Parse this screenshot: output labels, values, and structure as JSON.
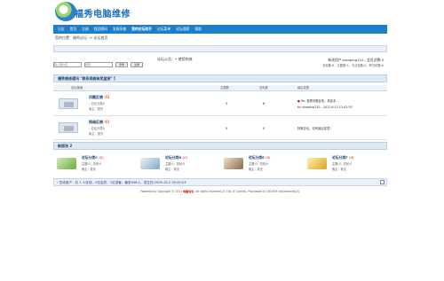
{
  "logo": {
    "name": "福秀电脑维修"
  },
  "nav": {
    "items": [
      "日志",
      "首页",
      "注册",
      "找回密码",
      "发表风格",
      "我的论坛助手",
      "论坛菜单",
      "论坛搜索",
      "帮助"
    ],
    "active_index": 5
  },
  "breadcrumb": "您的位置：福秀论坛 -> 论坛首页",
  "info": {
    "announce": "论坛公告：• 使用的体",
    "newest_member": "新进用户:xiaoping110，会员总数:3",
    "stats": "总帖数:8，主题数:5，今日帖数:0，昨日帖数:0"
  },
  "login": {
    "user_placeholder": "输入用户名",
    "pass_placeholder": "密码",
    "login_btn": "登录",
    "register_btn": "注册"
  },
  "section1": {
    "title": "福秀维修通讯 \"联系网络有奖鉴赏\" 】",
    "col_forum": "论坛版面",
    "col_topics": "主题数",
    "col_posts": "总帖数",
    "col_last": "最后发表"
  },
  "forums": [
    {
      "name": "问题反馈",
      "count": "(0)",
      "sub": "› 论坛分类A",
      "moderator": "版主：暂无",
      "topics": "5",
      "posts": "8",
      "last1": "Re: 宽屏问题反馈，求高手...",
      "last2": "by  xiaoping110 - 2012-6-12 11:03:55"
    },
    {
      "name": "网络反馈",
      "count": "(0)",
      "sub": "› 论坛分类B",
      "moderator": "版主：暂无",
      "topics": "0",
      "posts": "0",
      "last1": "",
      "last2": "特殊论坛，没有最后发表！"
    }
  ],
  "section2": {
    "title": "新版块 2"
  },
  "categories": [
    {
      "name": "论坛分类C",
      "count": "(0)",
      "line1": "主题:0，总帖:0",
      "line2": "版主：暂无"
    },
    {
      "name": "论坛分类D",
      "count": "(0)",
      "line1": "主题:0，总帖:0",
      "line2": "版主：暂无"
    },
    {
      "name": "论坛分类E",
      "count": "(0)",
      "line1": "主题:0，总帖:0",
      "line2": "版主：暂无"
    },
    {
      "name": "论坛分类F",
      "count": "(0)",
      "line1": "主题:0，总帖:0",
      "line2": "版主：暂无"
    }
  ],
  "status": "› 在线用户 - 共 1 人在线，0位会员，1位游客，最多506人，发生在:2009-10-2 20:05:23",
  "footer": {
    "prefix": "Powered by Copyright © 2011 ",
    "brand": "电脑论坛",
    "suffix": ". All rights reserved.21 Call, 8 Queries, Processed in 140.629 milliseconds(2)."
  },
  "colors": {
    "accent": "#1e7fc8",
    "link_red": "#d00"
  }
}
